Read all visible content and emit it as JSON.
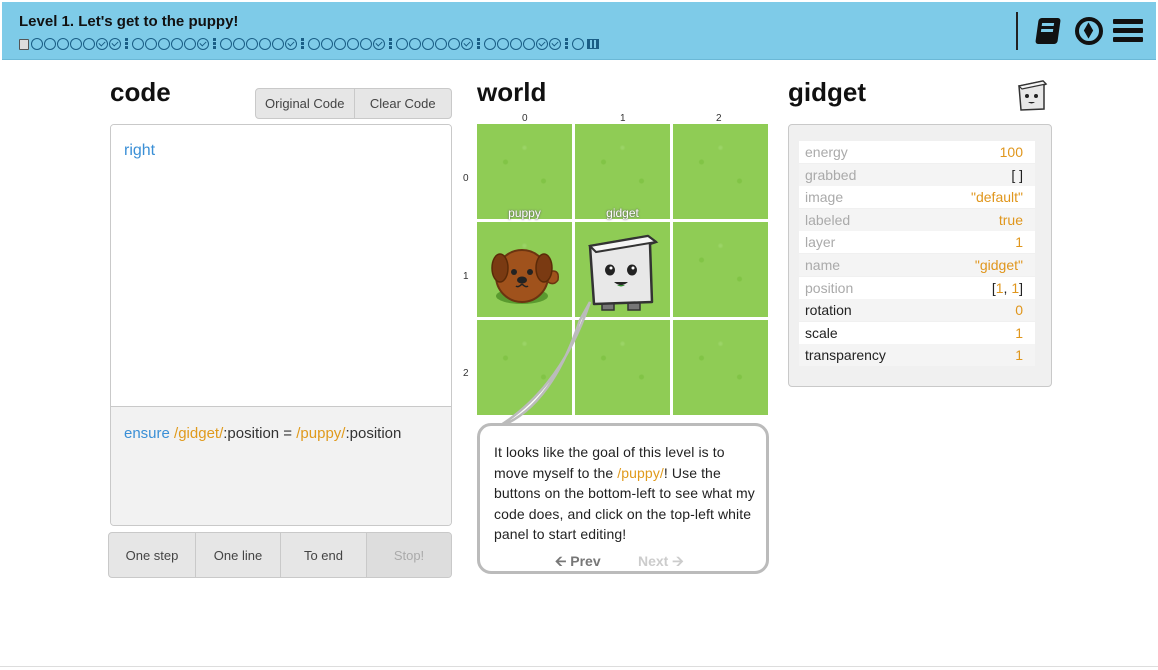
{
  "header": {
    "title": "Level 1. Let's get to the puppy!",
    "progress_groups": [
      {
        "open": 5,
        "done": 2
      },
      {
        "open": 5,
        "done": 1
      },
      {
        "open": 5,
        "done": 1
      },
      {
        "open": 5,
        "done": 1
      },
      {
        "open": 5,
        "done": 1
      },
      {
        "open": 4,
        "done": 2
      },
      {
        "open": 1,
        "done": 0
      }
    ],
    "icons": [
      "book-icon",
      "compass-icon",
      "menu-icon"
    ],
    "bg_color": "#7ecbe8"
  },
  "code": {
    "heading": "code",
    "buttons": {
      "original": "Original Code",
      "clear": "Clear Code"
    },
    "program": "right",
    "goal": {
      "kw": "ensure",
      "obj1": "/gidget/",
      "prop1": ":position",
      "eq": " = ",
      "obj2": "/puppy/",
      "prop2": ":position"
    },
    "controls": {
      "step": "One step",
      "line": "One line",
      "end": "To end",
      "stop": "Stop!"
    }
  },
  "world": {
    "heading": "world",
    "cols": [
      "0",
      "1",
      "2"
    ],
    "rows": [
      "0",
      "1",
      "2"
    ],
    "labels": {
      "puppy": "puppy",
      "gidget": "gidget"
    },
    "speech": {
      "pre": "It looks like the goal of this level is to move myself to the ",
      "name": "/puppy/",
      "post": "! Use the buttons on the bottom-left to see what my code does, and click on the top-left white panel to start editing!",
      "prev": "Prev",
      "next": "Next"
    }
  },
  "gidget": {
    "heading": "gidget",
    "props": [
      {
        "key": "energy",
        "value": "100"
      },
      {
        "key": "grabbed",
        "value": "[ ]"
      },
      {
        "key": "image",
        "value": "\"default\""
      },
      {
        "key": "labeled",
        "value": "true"
      },
      {
        "key": "layer",
        "value": "1"
      },
      {
        "key": "name",
        "value": "\"gidget\""
      },
      {
        "key": "position",
        "value": "[1, 1]",
        "x": "1",
        "y": "1"
      },
      {
        "key": "rotation",
        "value": "0"
      },
      {
        "key": "scale",
        "value": "1"
      },
      {
        "key": "transparency",
        "value": "1"
      }
    ]
  }
}
